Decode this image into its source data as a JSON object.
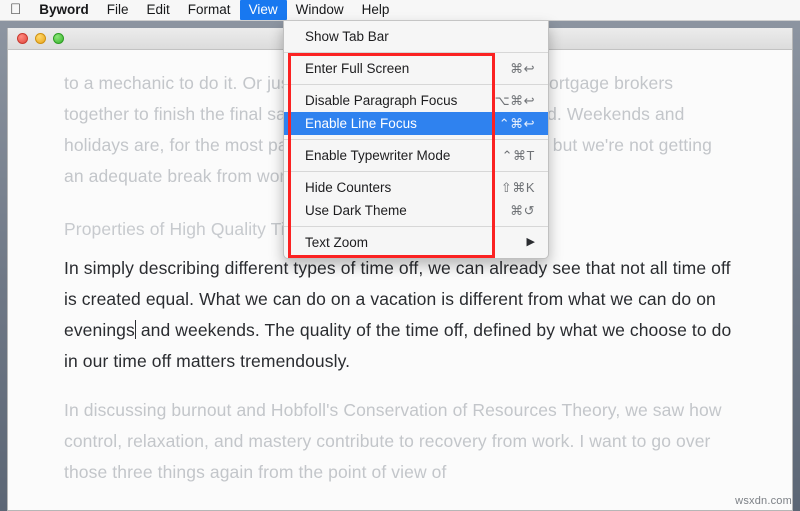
{
  "menubar": {
    "apple_icon": "apple-logo",
    "items": [
      {
        "label": "Byword",
        "selected": false
      },
      {
        "label": "File",
        "selected": false
      },
      {
        "label": "Edit",
        "selected": false
      },
      {
        "label": "Format",
        "selected": false
      },
      {
        "label": "View",
        "selected": true
      },
      {
        "label": "Window",
        "selected": false
      },
      {
        "label": "Help",
        "selected": false
      }
    ]
  },
  "window": {
    "traffic_lights": [
      "close",
      "minimize",
      "zoom"
    ]
  },
  "view_menu": {
    "groups": [
      {
        "items": [
          {
            "label": "Show Tab Bar",
            "shortcut": "",
            "highlighted": false,
            "submenu": false
          }
        ]
      },
      {
        "items": [
          {
            "label": "Enter Full Screen",
            "shortcut": "⌘↩",
            "highlighted": false,
            "submenu": false
          }
        ]
      },
      {
        "items": [
          {
            "label": "Disable Paragraph Focus",
            "shortcut": "⌥⌘↩",
            "highlighted": false,
            "submenu": false
          },
          {
            "label": "Enable Line Focus",
            "shortcut": "⌃⌘↩",
            "highlighted": true,
            "submenu": false
          }
        ]
      },
      {
        "items": [
          {
            "label": "Enable Typewriter Mode",
            "shortcut": "⌃⌘T",
            "highlighted": false,
            "submenu": false
          }
        ]
      },
      {
        "items": [
          {
            "label": "Hide Counters",
            "shortcut": "⇧⌘K",
            "highlighted": false,
            "submenu": false
          },
          {
            "label": "Use Dark Theme",
            "shortcut": "⌘↺",
            "highlighted": false,
            "submenu": false
          }
        ]
      },
      {
        "items": [
          {
            "label": "Text Zoom",
            "shortcut": "",
            "highlighted": false,
            "submenu": true
          }
        ]
      }
    ]
  },
  "document": {
    "paragraph_above": "to a mechanic to do it. Or just try getting all the lawyers and mortgage brokers together to finish the final sale of a home to do it on a weekend. Weekends and holidays are, for the most part, time when we are not working, but we're not getting an adequate break from work.",
    "heading": "Properties of High Quality Time Off",
    "paragraph_focused_part1": "In simply describing different types of time off, we can already see that not all time off is created equal. What we can do on a vacation is different from what we can do on evenings",
    "paragraph_focused_part2": " and weekends. The quality of the time off, defined by what we choose to do in our time off matters tremendously.",
    "paragraph_below": "In discussing burnout and Hobfoll's Conservation of Resources Theory, we saw how control, relaxation, and mastery contribute to recovery from work. I want to go over those three things again from the point of view of"
  },
  "annotation": {
    "color": "#fb2222",
    "shape": "rectangle"
  },
  "watermark": {
    "text": "wsxdn.com"
  },
  "colors": {
    "menu_highlight": "#2f82ef",
    "menubar_selected": "#1878f0",
    "annotation_red": "#fb2222",
    "dim_text": "#c3c6ca",
    "focus_text": "#2a2c30"
  }
}
